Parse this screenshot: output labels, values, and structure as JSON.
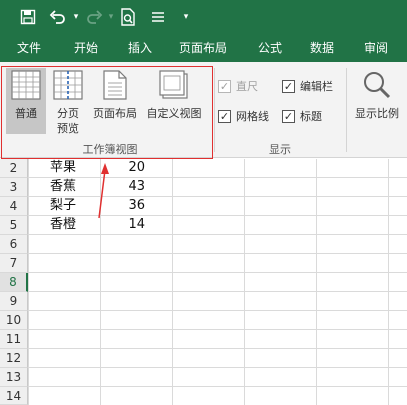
{
  "tabs": [
    "文件",
    "开始",
    "插入",
    "页面布局",
    "公式",
    "数据",
    "审阅"
  ],
  "views": {
    "normal": "普通",
    "page_break_line1": "分页",
    "page_break_line2": "预览",
    "page_layout": "页面布局",
    "custom_views": "自定义视图",
    "group_label": "工作簿视图"
  },
  "show": {
    "ruler": "直尺",
    "formula_bar": "编辑栏",
    "gridlines": "网格线",
    "headings": "标题",
    "group_label": "显示"
  },
  "zoom_label": "显示比例",
  "row_headers": [
    "2",
    "3",
    "4",
    "5",
    "6",
    "7",
    "8",
    "9",
    "10",
    "11",
    "12",
    "13",
    "14"
  ],
  "active_row": "8",
  "rows": [
    {
      "name": "苹果",
      "qty": "20"
    },
    {
      "name": "香蕉",
      "qty": "43"
    },
    {
      "name": "梨子",
      "qty": "36"
    },
    {
      "name": "香橙",
      "qty": "14"
    }
  ],
  "checkbox_states": {
    "ruler": false,
    "formula_bar": true,
    "gridlines": true,
    "headings": true
  },
  "colors": {
    "accent": "#217346",
    "highlight": "#e03030"
  }
}
